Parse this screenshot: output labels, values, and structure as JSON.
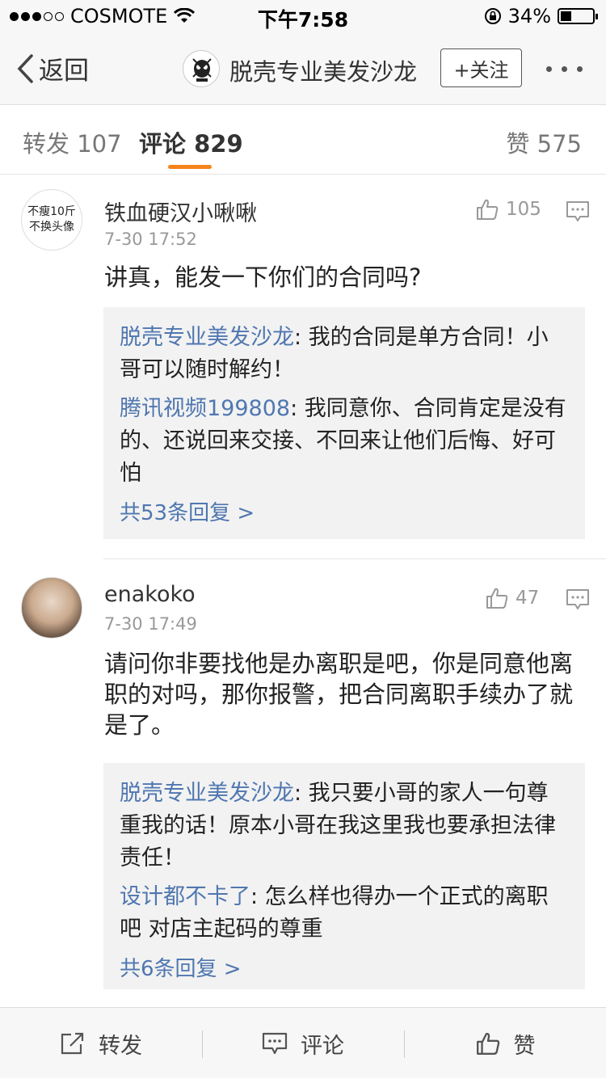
{
  "status_bar": {
    "carrier": "COSMOTE",
    "time": "下午7:58",
    "battery": "34%",
    "battery_level": 0.34,
    "signal_bars_filled": 3,
    "signal_bars_total": 5
  },
  "nav": {
    "back_label": "返回",
    "title": "脱壳专业美发沙龙",
    "follow_label": "+关注"
  },
  "tabs": {
    "repost": {
      "label": "转发",
      "count": "107"
    },
    "comment": {
      "label": "评论",
      "count": "829"
    },
    "like": {
      "label": "赞",
      "count": "575"
    },
    "active": "comment",
    "accent_color": "#f7821b"
  },
  "comments": [
    {
      "avatar_text_1": "不瘦10斤",
      "avatar_text_2": "不换头像",
      "name": "铁血硬汉小啾啾",
      "time": "7-30 17:52",
      "likes": "105",
      "text": "讲真，能发一下你们的合同吗?",
      "replies": [
        {
          "who": "脱壳专业美发沙龙",
          "text": ": 我的合同是单方合同！小哥可以随时解约！"
        },
        {
          "who": "腾讯视频199808",
          "text": ": 我同意你、合同肯定是没有的、还说回来交接、不回来让他们后悔、好可怕"
        }
      ],
      "more_replies": "共53条回复 >"
    },
    {
      "name": "enakoko",
      "time": "7-30 17:49",
      "likes": "47",
      "text": "请问你非要找他是办离职是吧，你是同意他离职的对吗，那你报警，把合同离职手续办了就是了。",
      "replies": [
        {
          "who": "脱壳专业美发沙龙",
          "text": ": 我只要小哥的家人一句尊重我的话！原本小哥在我这里我也要承担法律责任！"
        },
        {
          "who": "设计都不卡了",
          "text": ": 怎么样也得办一个正式的离职吧 对店主起码的尊重"
        }
      ],
      "more_replies": "共6条回复 >"
    }
  ],
  "toolbar": {
    "repost": "转发",
    "comment": "评论",
    "like": "赞"
  },
  "colors": {
    "link": "#4f77b0",
    "accent": "#f7821b"
  }
}
